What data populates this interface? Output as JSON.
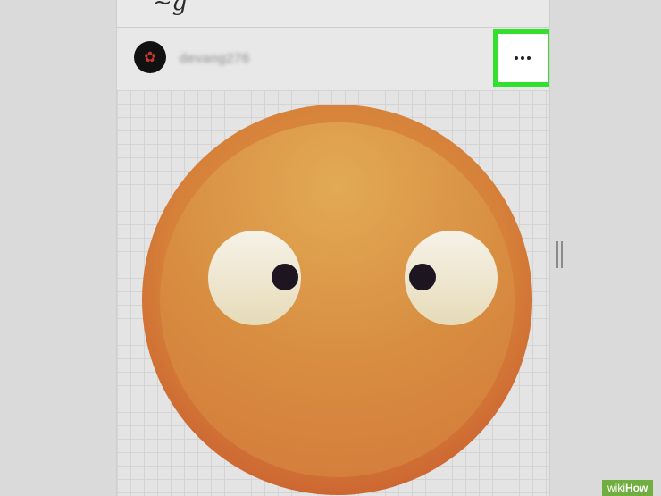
{
  "header": {
    "logo_text": "~g",
    "username": "devang276",
    "avatar_glyph": "✿",
    "more_button_label": "..."
  },
  "highlight": {
    "color": "#33e02e"
  },
  "post": {
    "image": "orange-emoji-face"
  },
  "watermark": {
    "part1": "wiki",
    "part2": "How"
  }
}
